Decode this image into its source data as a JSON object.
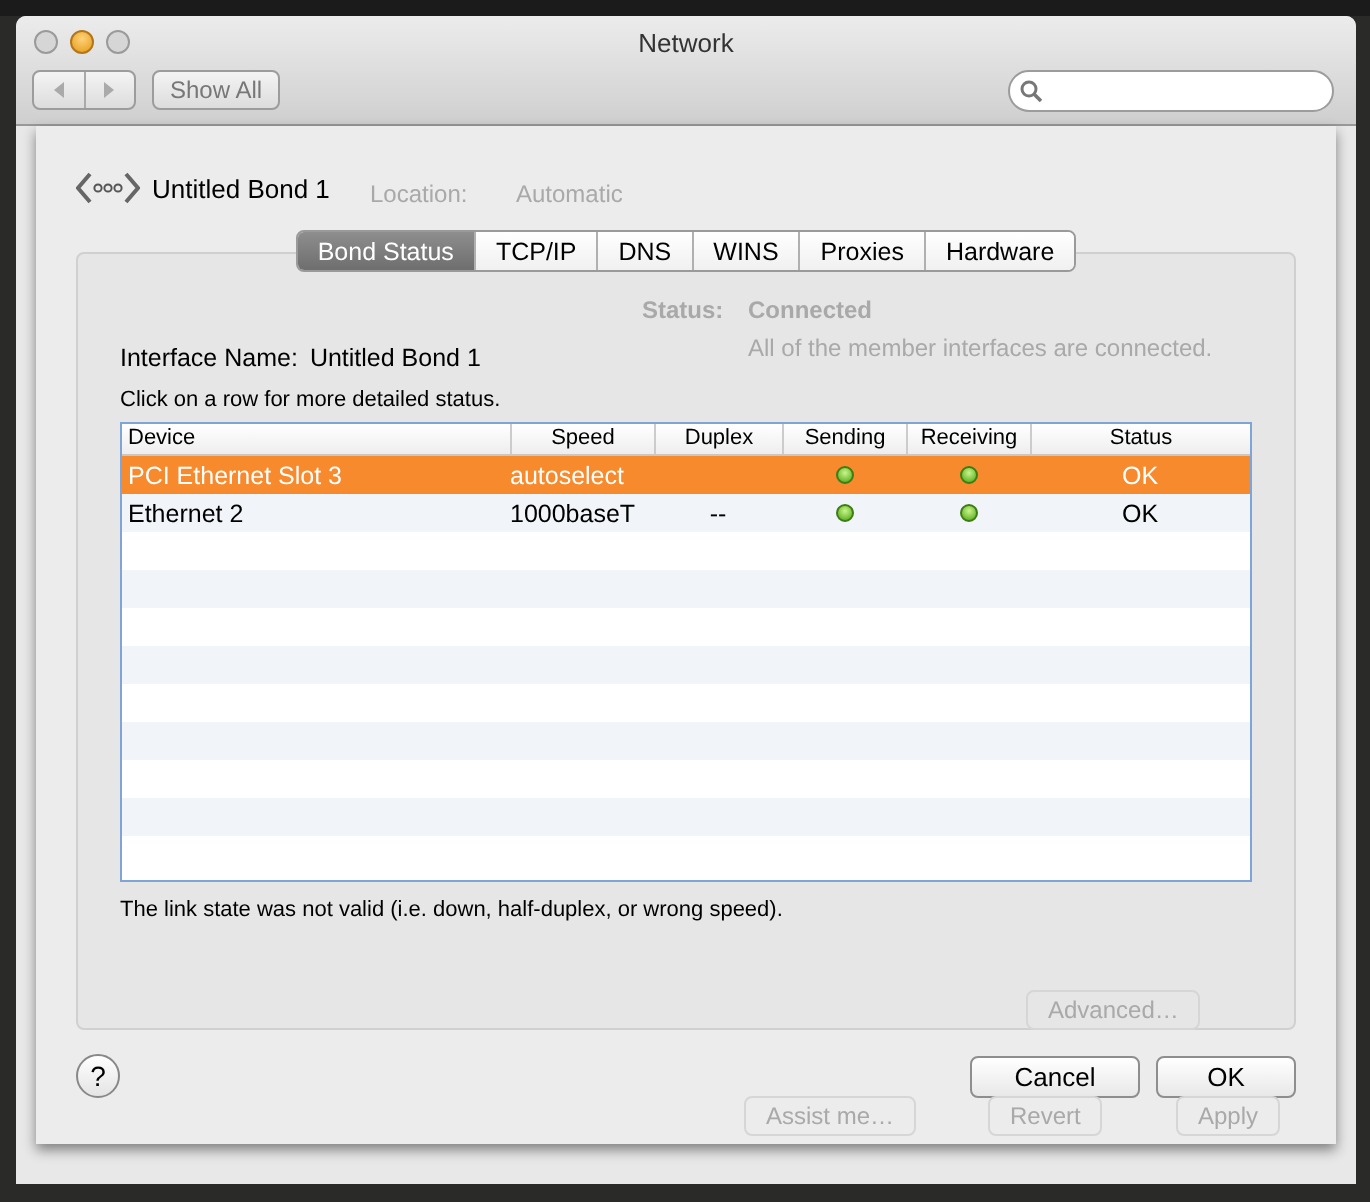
{
  "window": {
    "title": "Network",
    "show_all": "Show All"
  },
  "behind_sheet": {
    "location_label": "Location:",
    "location_value": "Automatic",
    "status_label": "Status:",
    "status_value": "Connected",
    "status_note": "All of the member interfaces are connected.",
    "advanced": "Advanced…",
    "assist": "Assist me…",
    "revert": "Revert",
    "apply": "Apply"
  },
  "sheet": {
    "interface_title": "Untitled Bond 1",
    "tabs": [
      {
        "label": "Bond Status",
        "selected": true
      },
      {
        "label": "TCP/IP",
        "selected": false
      },
      {
        "label": "DNS",
        "selected": false
      },
      {
        "label": "WINS",
        "selected": false
      },
      {
        "label": "Proxies",
        "selected": false
      },
      {
        "label": "Hardware",
        "selected": false
      }
    ],
    "interface_name_label": "Interface Name:",
    "interface_name": "Untitled Bond 1",
    "hint": "Click on a row for more detailed status.",
    "table": {
      "columns": [
        "Device",
        "Speed",
        "Duplex",
        "Sending",
        "Receiving",
        "Status"
      ],
      "rows": [
        {
          "device": "PCI Ethernet Slot 3",
          "speed": "autoselect",
          "sending": true,
          "receiving": true,
          "status": "OK",
          "selected": true
        },
        {
          "device": "Ethernet 2",
          "speed": "1000baseT",
          "duplex": "--",
          "sending": true,
          "receiving": true,
          "status": "OK",
          "selected": false
        }
      ]
    },
    "note": "The link state was not valid (i.e. down, half-duplex, or wrong speed).",
    "help": "?",
    "buttons": [
      "Cancel",
      "OK"
    ]
  }
}
